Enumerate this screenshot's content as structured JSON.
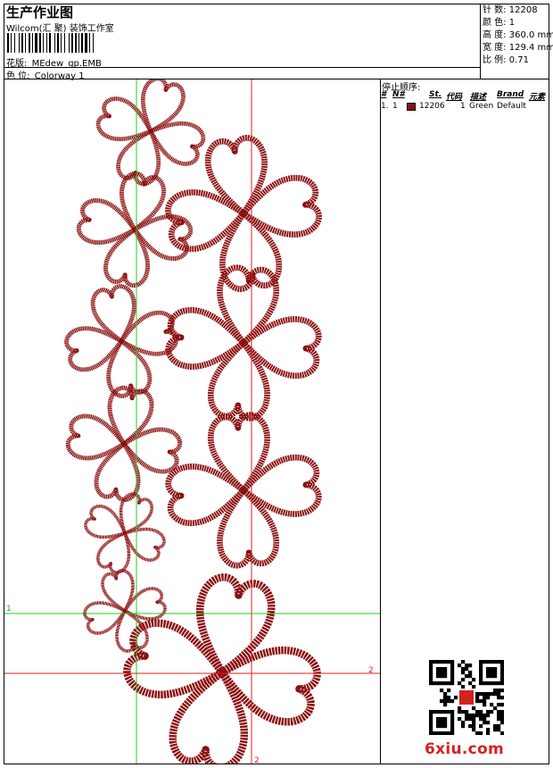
{
  "header": {
    "title": "生产作业图",
    "company": "Wilcom(汇 聚) 装饰工作室",
    "design_label": "花版:",
    "design_value": "MEdew_gp.EMB",
    "colorway_label": "色 位:",
    "colorway_value": "Colorway 1"
  },
  "stats": [
    {
      "label": "针 数:",
      "value": "12208"
    },
    {
      "label": "颜 色:",
      "value": "1"
    },
    {
      "label": "高 度:",
      "value": "360.0 mm"
    },
    {
      "label": "宽 度:",
      "value": "129.4 mm"
    },
    {
      "label": "比 例:",
      "value": "0.71"
    }
  ],
  "stop_sequence": {
    "title": "停止顺序:",
    "headers": {
      "hash": "#",
      "no": "N#",
      "st": "St.",
      "code": "代码",
      "desc": "描述",
      "brand": "Brand",
      "element": "元素"
    },
    "rows": [
      {
        "hash": "1.",
        "no": "1",
        "st": "12206",
        "code": "1",
        "desc": "Green",
        "brand": "Default",
        "color": "#8b1010"
      }
    ]
  },
  "guides": {
    "h1_label": "1",
    "h2_label": "2",
    "v2_label": "2",
    "v1_color": "#22cc22",
    "v2_color": "#dd2222"
  },
  "thread_color": "#8b1010",
  "watermark": {
    "site": "6xiu.com"
  }
}
